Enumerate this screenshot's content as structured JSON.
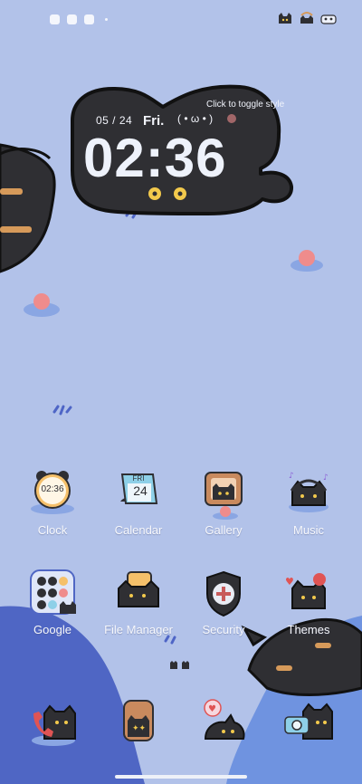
{
  "status_bar": {
    "left_icons": [
      "pinwheel-icon",
      "square-icon",
      "image-icon",
      "dot-icon"
    ],
    "right_icons": [
      "cat-icon",
      "wifi-cat-icon",
      "battery-cat-icon"
    ]
  },
  "widget": {
    "hint": "Click to toggle style",
    "date": "05 / 24",
    "day": "Fri.",
    "face": "( • ω • )",
    "time": "02:36"
  },
  "calendar_icon": {
    "day": "FRI",
    "date": "24"
  },
  "clock_icon": {
    "time": "02:36"
  },
  "apps": {
    "clock": "Clock",
    "calendar": "Calendar",
    "gallery": "Gallery",
    "music": "Music",
    "google": "Google",
    "file_manager": "File Manager",
    "security": "Security",
    "themes": "Themes"
  },
  "dock": [
    "phone-icon",
    "messages-icon",
    "browser-icon",
    "camera-icon"
  ],
  "colors": {
    "background": "#b2c2e9",
    "cat": "#2f2f33",
    "blob_dark": "#4f66c4",
    "blob_light": "#6f93e0"
  }
}
